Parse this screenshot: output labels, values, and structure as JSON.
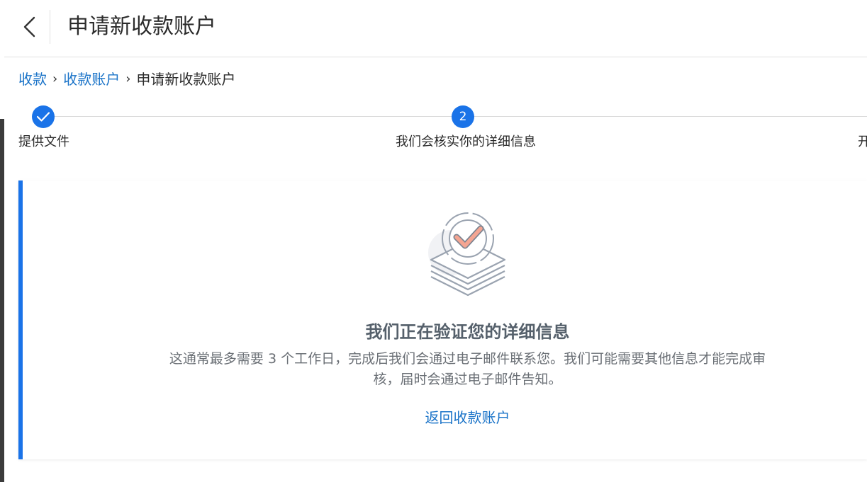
{
  "header": {
    "title": "申请新收款账户",
    "back_icon": "chevron-left-icon"
  },
  "breadcrumb": {
    "items": [
      "收款",
      "收款账户",
      "申请新收款账户"
    ],
    "separator": "›"
  },
  "stepper": {
    "steps": [
      {
        "label": "提供文件",
        "status": "completed",
        "icon": "check-icon"
      },
      {
        "label": "我们会核实你的详细信息",
        "status": "current",
        "number": "2"
      },
      {
        "label": "开",
        "status": "pending"
      }
    ]
  },
  "card": {
    "title": "我们正在验证您的详细信息",
    "description": "这通常最多需要 3 个工作日，完成后我们会通过电子邮件联系您。我们可能需要其他信息才能完成审核，届时会通过电子邮件告知。",
    "link": "返回收款账户",
    "illustration": "verified-documents-icon"
  },
  "colors": {
    "accent": "#1a73e8",
    "link": "#1a73c8",
    "title": "#55606b",
    "check": "#f4a592"
  }
}
